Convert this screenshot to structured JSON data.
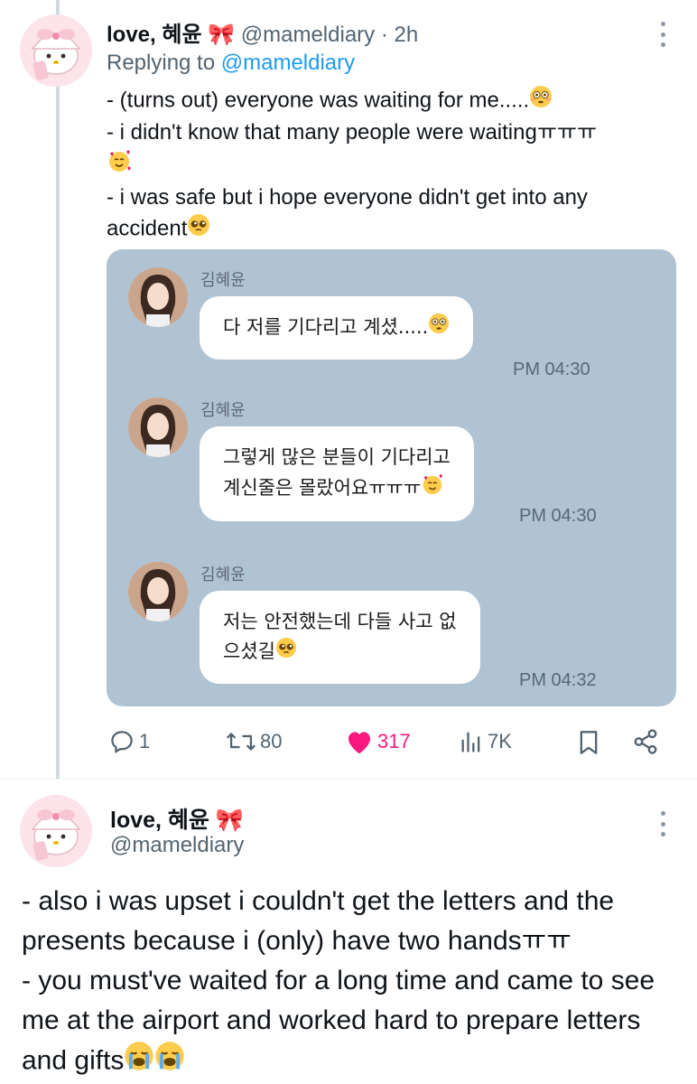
{
  "tweet1": {
    "display_name": "love, 혜윤",
    "name_emoji": "🎀",
    "handle": "@mameldiary",
    "time": "· 2h",
    "replying_prefix": "Replying to",
    "replying_to": "@mameldiary",
    "lines": [
      "- (turns out) everyone was waiting for me.....",
      "- i didn't know that many people were waitingㅠㅠㅠ",
      "- i was safe but i hope everyone didn't get into any accident"
    ],
    "chat": [
      {
        "sender": "김혜윤",
        "text": "다 저를 기다리고 계셨.....",
        "time": "PM 04:30"
      },
      {
        "sender": "김혜윤",
        "text_line1": "그렇게 많은 분들이 기다리고",
        "text_line2": "계신줄은 몰랐어요ㅠㅠㅠ",
        "time": "PM 04:30"
      },
      {
        "sender": "김혜윤",
        "text_line1": "저는 안전했는데 다들 사고 없",
        "text_line2": "으셨길",
        "time": "PM 04:32"
      }
    ],
    "actions": {
      "replies": "1",
      "retweets": "80",
      "likes": "317",
      "views": "7K"
    }
  },
  "tweet2": {
    "display_name": "love, 혜윤",
    "name_emoji": "🎀",
    "handle": "@mameldiary",
    "lines": [
      "- also i was upset i couldn't get the letters and the presents because i (only) have two handsㅠㅠ",
      "- you must've waited for a long time and came to see me at the airport and worked hard to prepare letters and gifts"
    ]
  },
  "colors": {
    "link": "#1d9bf0",
    "like": "#f91880",
    "chat_background": "#b0c3d3",
    "secondary_text": "#536471"
  },
  "icons": [
    "reply-icon",
    "retweet-icon",
    "heart-icon",
    "views-icon",
    "bookmark-icon",
    "share-icon",
    "more-icon"
  ]
}
